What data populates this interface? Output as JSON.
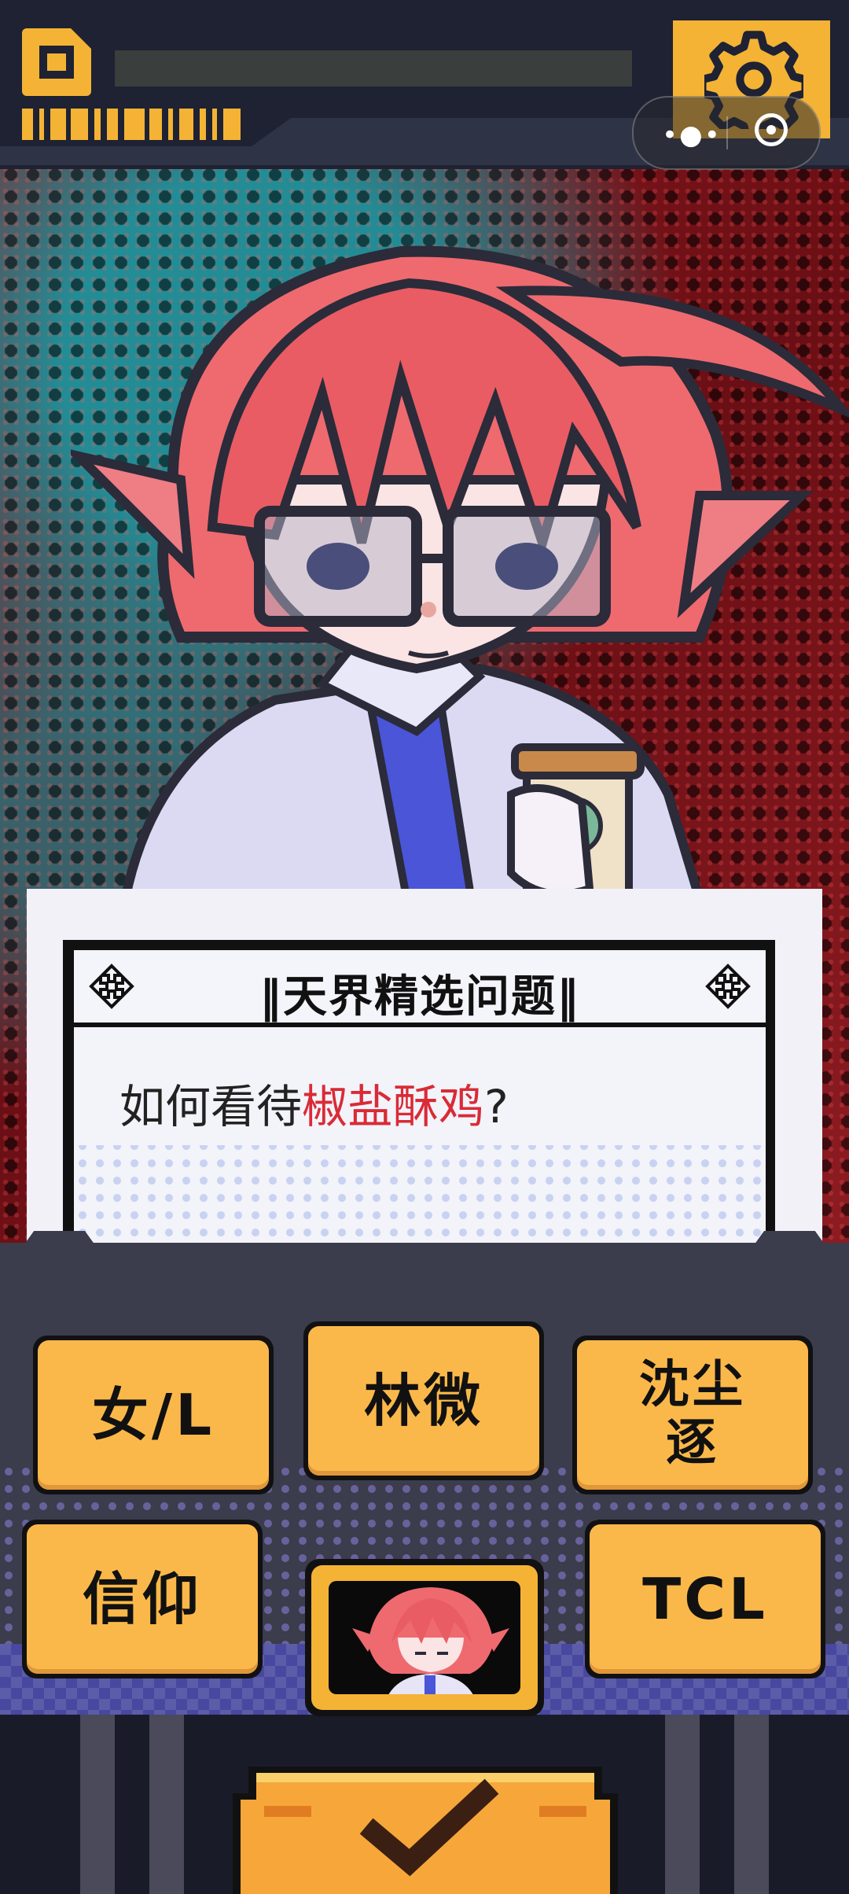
{
  "topbar": {
    "home_icon": "home-square-icon",
    "settings_icon": "gear-icon",
    "capsule": {
      "more_icon": "more-dots-icon",
      "close_icon": "target-close-icon"
    }
  },
  "card": {
    "title": "‖天界精选问题‖",
    "question_prefix": "如何看待",
    "question_highlight": "椒盐酥鸡",
    "question_suffix": "?",
    "corner_icon": "recycle-icon"
  },
  "answers": [
    {
      "label": "女/L"
    },
    {
      "label": "林微"
    },
    {
      "label": "沈尘逐"
    },
    {
      "label": "信仰"
    },
    {
      "label": "TCL"
    }
  ],
  "confirm": {
    "icon": "checkmark-icon"
  },
  "colors": {
    "accent": "#f4b335",
    "button": "#fbb84a",
    "highlight": "#d92b36",
    "dark": "#1e2233"
  }
}
